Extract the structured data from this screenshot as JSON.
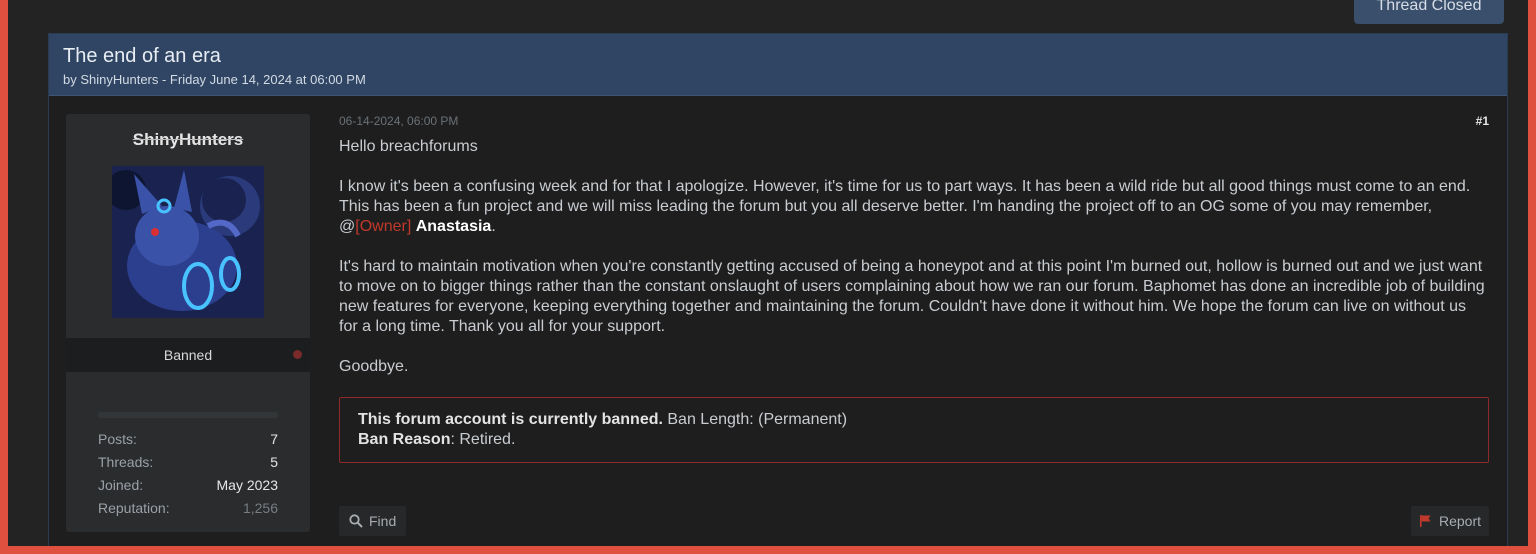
{
  "thread_status": {
    "label": "Thread Closed"
  },
  "thread": {
    "title": "The end of an era",
    "meta": "by ShinyHunters - Friday June 14, 2024 at 06:00 PM"
  },
  "author": {
    "username": "ShinyHunters",
    "role": "Banned",
    "stats": [
      {
        "label": "Posts:",
        "value": "7"
      },
      {
        "label": "Threads:",
        "value": "5"
      },
      {
        "label": "Joined:",
        "value": "May 2023"
      },
      {
        "label": "Reputation:",
        "value": "1,256"
      }
    ]
  },
  "post": {
    "date": "06-14-2024, 06:00 PM",
    "number": "#1",
    "greeting": "Hello breachforums",
    "para1": "I know it's been a confusing week and for that I apologize. However, it's time for us to part ways. It has been a wild ride but all good things must come to an end. This has been a fun project and we will miss leading the forum but you all deserve better. I'm handing the project off to an OG some of you may remember, @",
    "mention_role": "[Owner]",
    "mention_name": "Anastasia",
    "para1_end": ".",
    "para2": "It's hard to maintain motivation when you're constantly getting accused of being a honeypot and at this point I'm burned out, hollow is burned out and we just want to move on to bigger things rather than the constant onslaught of users complaining about how we ran our forum. Baphomet has done an incredible job of building new features for everyone, keeping everything together and maintaining the forum. Couldn't have done it without him. We hope the forum can live on without us for a long time. Thank you all for your support.",
    "closing": "Goodbye."
  },
  "ban_notice": {
    "heading": "This forum account is currently banned.",
    "length_text": " Ban Length: (Permanent)",
    "reason_label": "Ban Reason",
    "reason_text": ": Retired."
  },
  "actions": {
    "find_label": "Find",
    "report_label": "Report"
  },
  "colors": {
    "header_bg": "#2f4563",
    "ban_border": "#8e2a2a",
    "owner_red": "#c0392b"
  }
}
